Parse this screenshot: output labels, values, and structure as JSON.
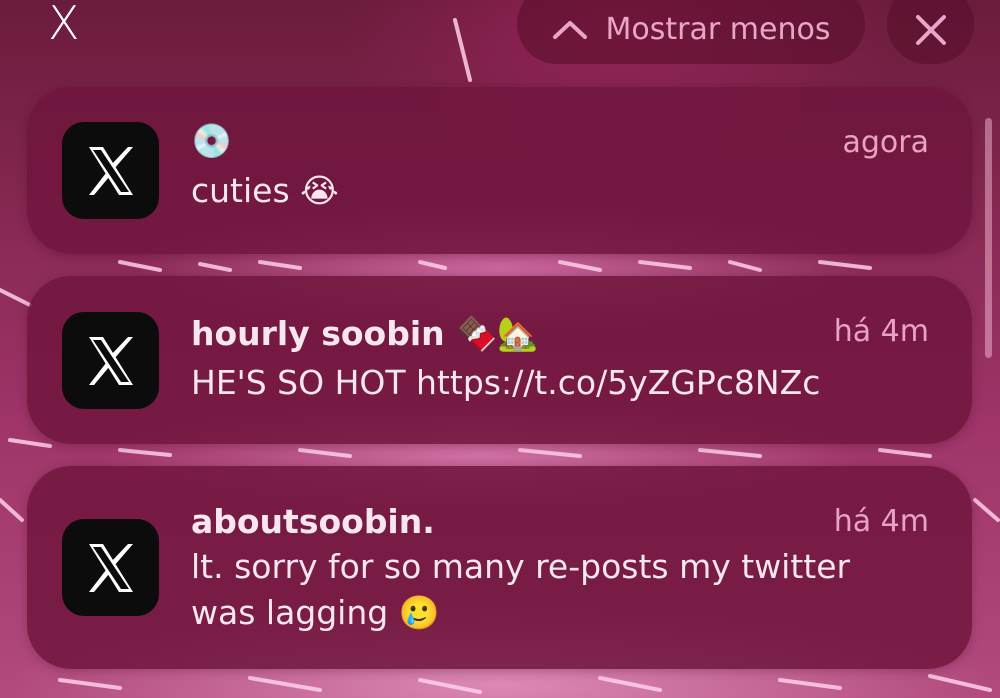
{
  "header": {
    "app_label": "X",
    "show_less_label": "Mostrar menos",
    "show_less_icon": "chevron-up-icon",
    "close_icon": "close-icon"
  },
  "notifications": [
    {
      "app_icon": "x-logo-icon",
      "title": "💿",
      "time": "agora",
      "body": "cuties 😭"
    },
    {
      "app_icon": "x-logo-icon",
      "title": "hourly soobin 🍫🏡",
      "time": "há 4m",
      "body": "HE'S SO HOT  https://t.co/5yZGPc8NZc"
    },
    {
      "app_icon": "x-logo-icon",
      "title": "aboutsoobin.",
      "time": "há 4m",
      "body": "lt. sorry for so many re-posts my twitter was lagging 🥲"
    }
  ],
  "colors": {
    "card_background": "#70163e",
    "secondary_text": "#e8a2c4",
    "primary_text": "#f6e6ee"
  }
}
